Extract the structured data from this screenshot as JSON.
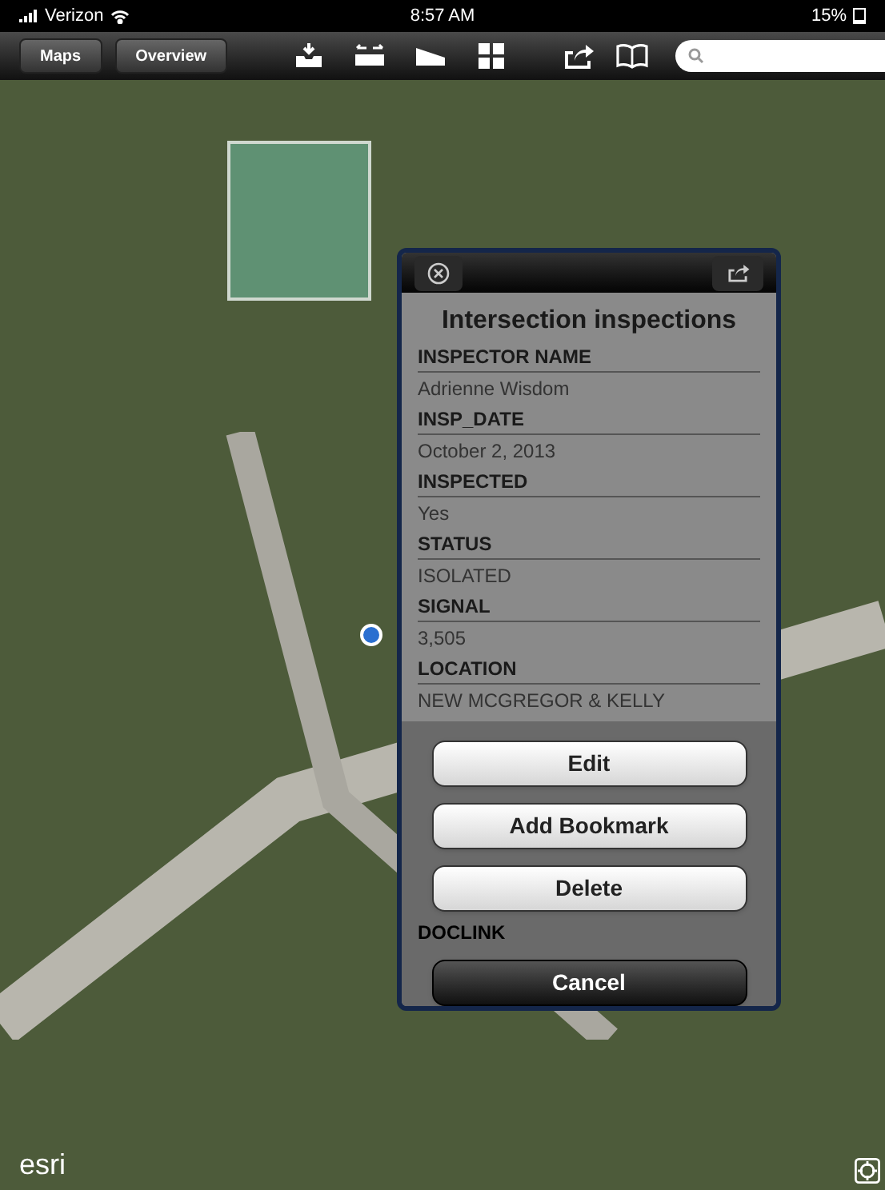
{
  "status_bar": {
    "carrier": "Verizon",
    "time": "8:57 AM",
    "battery": "15%"
  },
  "toolbar": {
    "buttons": [
      "Maps",
      "Overview"
    ]
  },
  "popup": {
    "title": "Intersection inspections",
    "fields": [
      {
        "label": "INSPECTOR NAME",
        "value": "Adrienne Wisdom"
      },
      {
        "label": "INSP_DATE",
        "value": "October 2, 2013"
      },
      {
        "label": "INSPECTED",
        "value": "Yes"
      },
      {
        "label": "STATUS",
        "value": "ISOLATED"
      },
      {
        "label": "SIGNAL",
        "value": "3,505"
      },
      {
        "label": "LOCATION",
        "value": "NEW MCGREGOR & KELLY"
      }
    ],
    "hidden_label": "DOCLINK"
  },
  "action_sheet": {
    "buttons": [
      {
        "label": "Edit",
        "kind": "default"
      },
      {
        "label": "Add Bookmark",
        "kind": "default"
      },
      {
        "label": "Delete",
        "kind": "default"
      },
      {
        "label": "Cancel",
        "kind": "cancel"
      }
    ]
  },
  "map": {
    "logo": "esri"
  }
}
